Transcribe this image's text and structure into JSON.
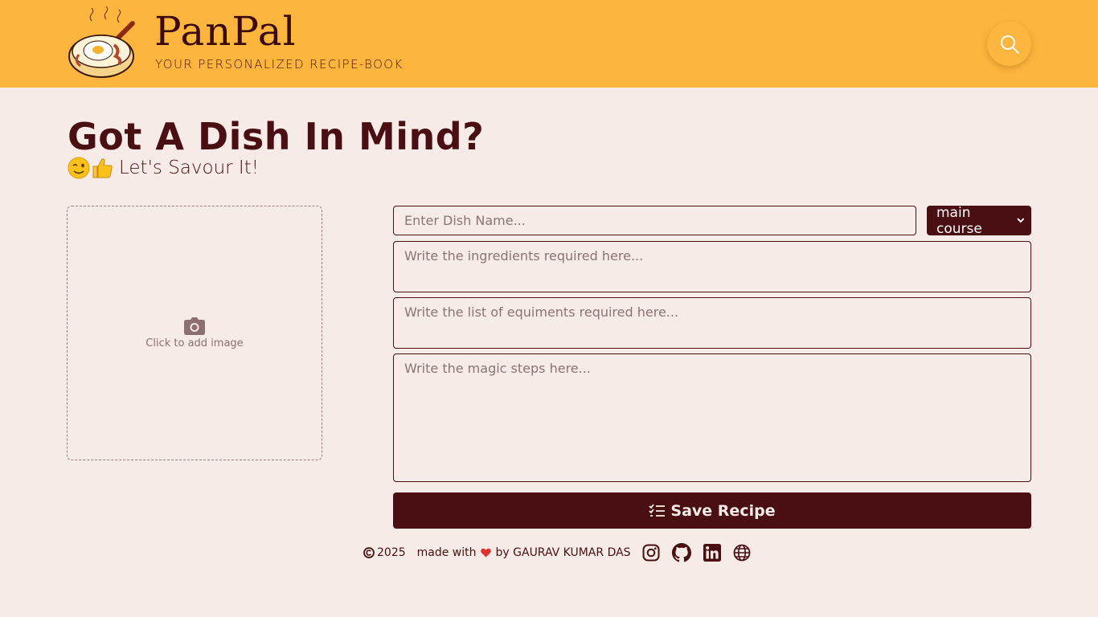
{
  "header": {
    "brand_title": "PanPal",
    "brand_tagline": "YOUR PERSONALIZED RECIPE-BOOK",
    "logo_icon": "frying-pan-egg-logo",
    "search_icon": "search-icon",
    "background_color": "#feb53e"
  },
  "hero": {
    "title": "Got A Dish In Mind?",
    "subtitle_emojis": [
      "winking-face-emoji",
      "thumbs-up-emoji"
    ],
    "subtitle": "Let's Savour It!"
  },
  "image_upload": {
    "icon": "camera-icon",
    "label": "Click to add image"
  },
  "form": {
    "dish_name_placeholder": "Enter Dish Name...",
    "course_selected": "main course",
    "ingredients_placeholder": "Write the ingredients required here...",
    "equipments_placeholder": "Write the list of equiments required here...",
    "steps_placeholder": "Write the magic steps here...",
    "save_label": "Save Recipe",
    "save_icon": "checklist-icon"
  },
  "footer": {
    "year": "2025",
    "made_with": "made with",
    "by_text": "by GAURAV KUMAR DAS",
    "social_icons": [
      "instagram-icon",
      "github-icon",
      "linkedin-icon",
      "globe-icon"
    ]
  },
  "colors": {
    "accent": "#4a0f12",
    "page_background": "#f7ebe7",
    "heart": "#e0312f"
  }
}
